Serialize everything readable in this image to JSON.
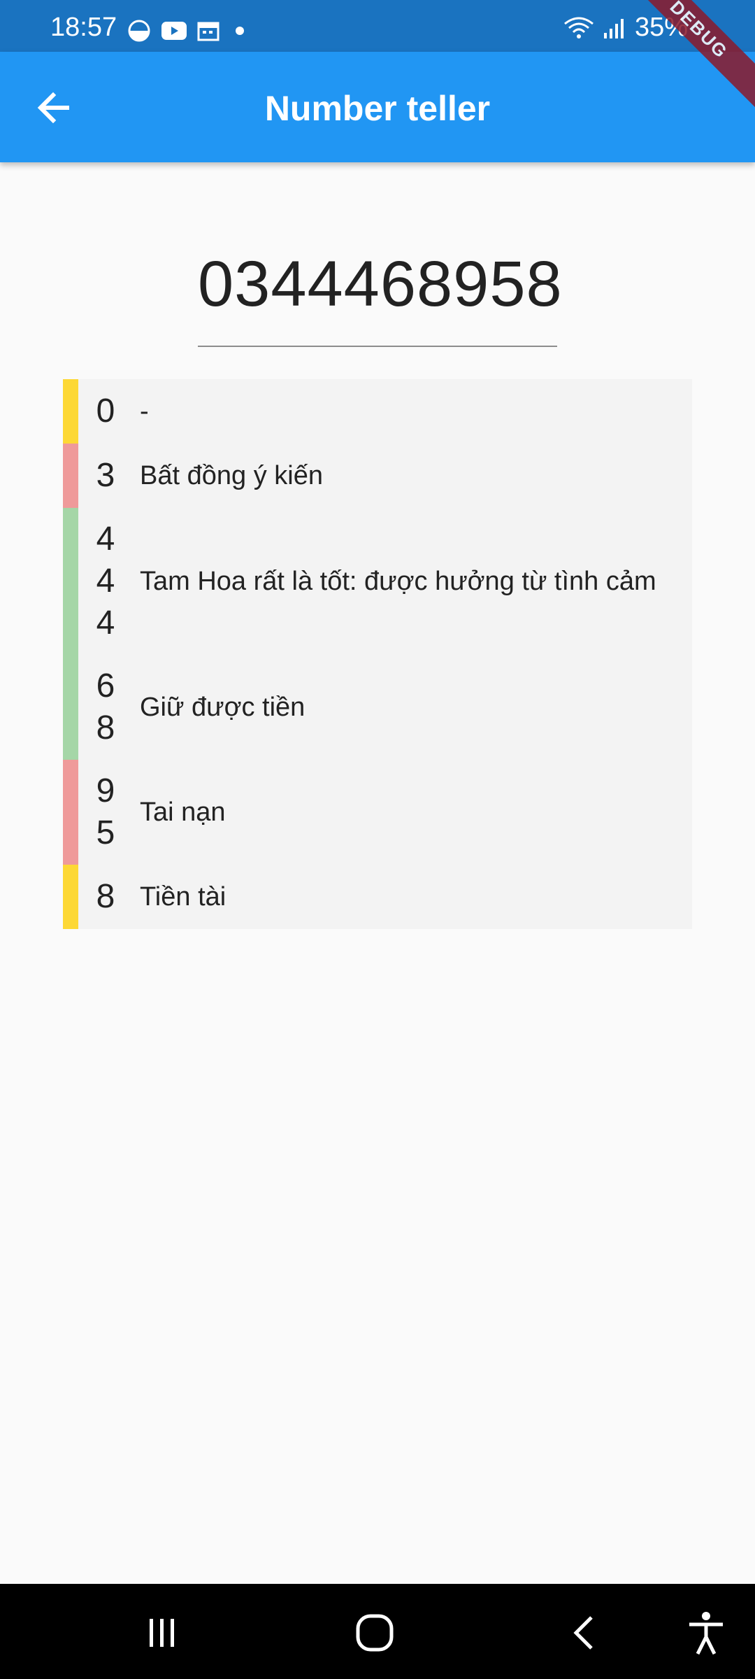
{
  "status_bar": {
    "time": "18:57",
    "battery": "35%"
  },
  "app_bar": {
    "title": "Number teller",
    "debug_label": "DEBUG"
  },
  "number": "0344468958",
  "meanings": [
    {
      "digits": [
        "0"
      ],
      "meaning": "-",
      "color": "#fdd835"
    },
    {
      "digits": [
        "3"
      ],
      "meaning": "Bất đồng ý kiến",
      "color": "#ef9a9a"
    },
    {
      "digits": [
        "4",
        "4",
        "4"
      ],
      "meaning": "Tam Hoa rất là tốt: được hưởng từ tình cảm",
      "color": "#a5d6a7"
    },
    {
      "digits": [
        "6",
        "8"
      ],
      "meaning": "Giữ được tiền",
      "color": "#a5d6a7"
    },
    {
      "digits": [
        "9",
        "5"
      ],
      "meaning": "Tai nạn",
      "color": "#ef9a9a"
    },
    {
      "digits": [
        "8"
      ],
      "meaning": "Tiền tài",
      "color": "#fdd835"
    }
  ],
  "icons": {
    "back": "arrow-left-icon",
    "nav_recents": "recents-icon",
    "nav_home": "home-icon",
    "nav_back": "back-icon",
    "nav_accessibility": "accessibility-icon"
  }
}
